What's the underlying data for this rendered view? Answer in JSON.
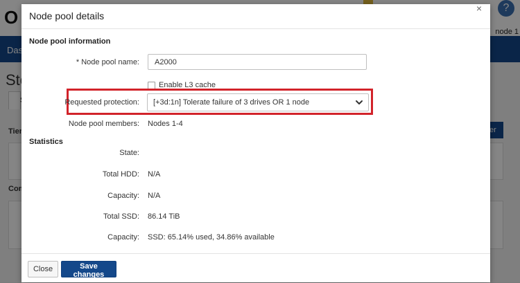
{
  "background": {
    "page_title_fragment": "Sto",
    "nav_fragment": "Das",
    "tab_fragment": "S",
    "tier_fragment": "Tier",
    "comp_fragment": "Com",
    "node_label": "node 1",
    "right_button_fragment": "er"
  },
  "modal": {
    "title": "Node pool details",
    "close_glyph": "×",
    "info_section": "Node pool information",
    "name_label": "* Node pool name:",
    "name_value": "A2000",
    "l3_cache_label": "Enable L3 cache",
    "l3_cache_checked": false,
    "protection_label": "Requested protection:",
    "protection_value": "[+3d:1n] Tolerate failure of 3 drives OR 1 node",
    "members_label": "Node pool members:",
    "members_value": "Nodes 1-4",
    "statistics_section": "Statistics",
    "stats": [
      {
        "label": "State:",
        "value": ""
      },
      {
        "label": "Total HDD:",
        "value": "N/A"
      },
      {
        "label": "Capacity:",
        "value": "N/A"
      },
      {
        "label": "Total SSD:",
        "value": "86.14 TiB"
      },
      {
        "label": "Capacity:",
        "value": "SSD: 65.14% used, 34.86% available"
      }
    ],
    "footer": {
      "close_label": "Close",
      "save_label": "Save changes"
    }
  },
  "colors": {
    "primary": "#14488a",
    "highlight": "#d2232a"
  }
}
